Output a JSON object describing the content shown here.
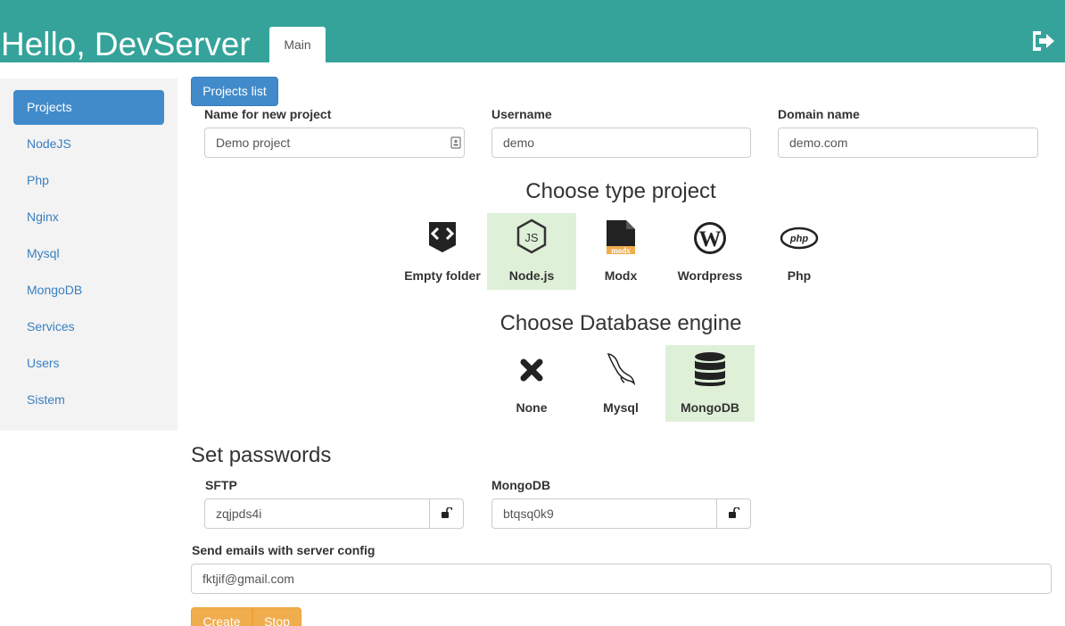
{
  "header": {
    "brand": "Hello, DevServer",
    "tab_main": "Main",
    "logout_icon": "sign-out-icon"
  },
  "sidebar": {
    "items": [
      {
        "label": "Projects",
        "active": true
      },
      {
        "label": "NodeJS"
      },
      {
        "label": "Php"
      },
      {
        "label": "Nginx"
      },
      {
        "label": "Mysql"
      },
      {
        "label": "MongoDB"
      },
      {
        "label": "Services"
      },
      {
        "label": "Users"
      },
      {
        "label": "Sistem"
      }
    ]
  },
  "main": {
    "projects_list_btn": "Projects list",
    "fields": {
      "name_label": "Name for new project",
      "name_value": "Demo project",
      "username_label": "Username",
      "username_value": "demo",
      "domain_label": "Domain name",
      "domain_value": "demo.com"
    },
    "type_title": "Choose type project",
    "types": [
      {
        "label": "Empty folder",
        "icon": "code-file-icon",
        "selected": false
      },
      {
        "label": "Node.js",
        "icon": "nodejs-icon",
        "selected": true
      },
      {
        "label": "Modx",
        "icon": "modx-file-icon",
        "selected": false
      },
      {
        "label": "Wordpress",
        "icon": "wordpress-icon",
        "selected": false
      },
      {
        "label": "Php",
        "icon": "php-icon",
        "selected": false
      }
    ],
    "db_title": "Choose Database engine",
    "databases": [
      {
        "label": "None",
        "icon": "x-icon",
        "selected": false
      },
      {
        "label": "Mysql",
        "icon": "mysql-dolphin-icon",
        "selected": false
      },
      {
        "label": "MongoDB",
        "icon": "database-icon",
        "selected": true
      }
    ],
    "passwords_title": "Set passwords",
    "sftp_label": "SFTP",
    "sftp_value": "zqjpds4i",
    "mongodb_label": "MongoDB",
    "mongodb_value": "btqsq0k9",
    "email_label": "Send emails with server config",
    "email_value": "fktjif@gmail.com",
    "create_btn": "Create",
    "stop_btn": "Stop"
  },
  "colors": {
    "header": "#35a39a",
    "primary": "#428bca",
    "selected": "#dff0d8",
    "warning": "#f0ad4e"
  }
}
